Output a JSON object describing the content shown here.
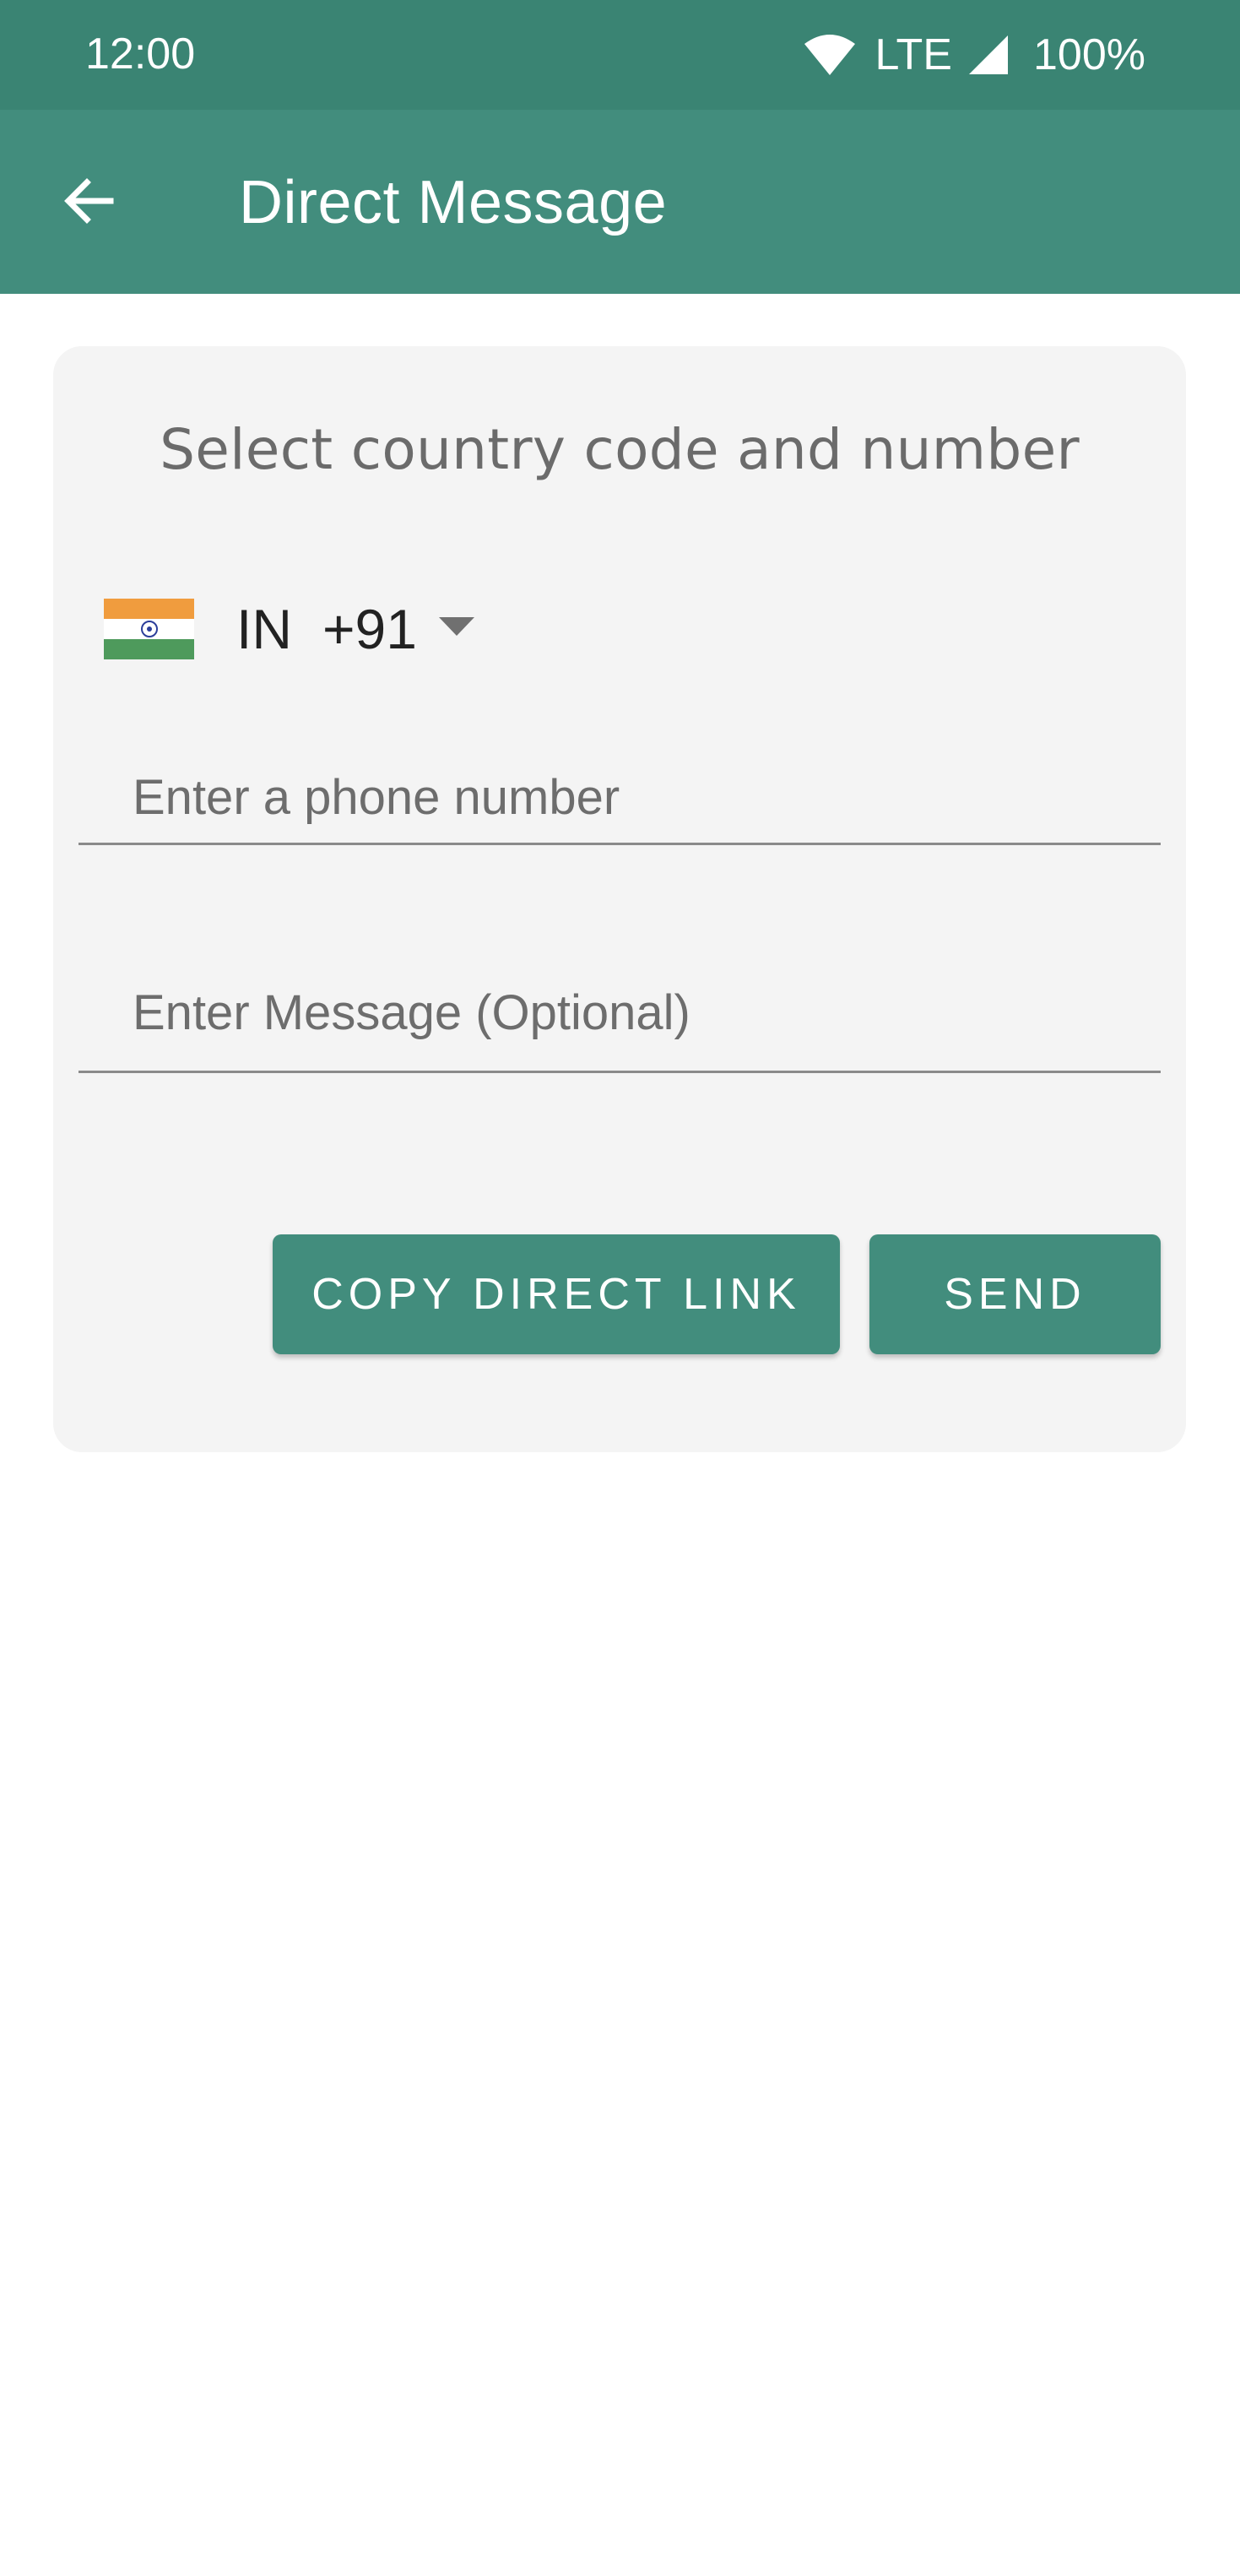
{
  "status_bar": {
    "time": "12:00",
    "network": "LTE",
    "battery": "100%"
  },
  "app_bar": {
    "title": "Direct Message",
    "back_icon": "arrow-back-icon"
  },
  "card": {
    "heading": "Select country code and number",
    "country": {
      "flag_icon": "india-flag-icon",
      "iso": "IN",
      "dial_code": "+91"
    },
    "phone_field": {
      "placeholder": "Enter a phone number",
      "value": ""
    },
    "message_field": {
      "placeholder": "Enter Message (Optional)",
      "value": ""
    },
    "buttons": {
      "copy_link": "COPY DIRECT LINK",
      "send": "SEND"
    }
  },
  "colors": {
    "status_bar": "#3a8473",
    "primary": "#428d7d",
    "card_background": "#f4f4f4"
  }
}
